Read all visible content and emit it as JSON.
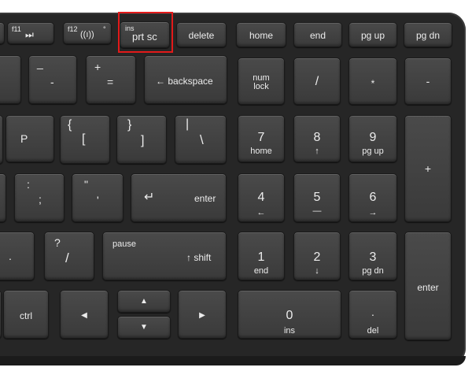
{
  "image": {
    "description_colors": {
      "frame": "#262626",
      "key": "#404040",
      "legend": "#ececec",
      "highlight": "#e21a1a"
    }
  },
  "keys": {
    "fn_next": {
      "fn": "f11",
      "icon": "⏭"
    },
    "fn_wireless": {
      "fn": "f12",
      "icon": "((ı))"
    },
    "prtsc": {
      "top": "ins",
      "main": "prt sc"
    },
    "delete": "delete",
    "home": "home",
    "end": "end",
    "pgup": "pg up",
    "pgdn": "pg dn",
    "minus": {
      "top": "_",
      "bottom": "-"
    },
    "equals": {
      "top": "+",
      "bottom": "="
    },
    "backspace": "← backspace",
    "numlock": {
      "line1": "num",
      "line2": "lock"
    },
    "num_slash": "/",
    "num_star": "*",
    "num_minus": "-",
    "p": "P",
    "lbracket": {
      "top": "{",
      "bottom": "["
    },
    "rbracket": {
      "top": "}",
      "bottom": "]"
    },
    "backslash": {
      "top": "|",
      "bottom": "\\"
    },
    "num7": {
      "digit": "7",
      "sub": "home"
    },
    "num8": {
      "digit": "8",
      "sub": "↑"
    },
    "num9": {
      "digit": "9",
      "sub": "pg up"
    },
    "num_plus": "+",
    "semicolon": {
      "top": ":",
      "bottom": ";"
    },
    "quote": {
      "top": "\"",
      "bottom": "'"
    },
    "enter": {
      "arrow": "↵",
      "label": "enter"
    },
    "num4": {
      "digit": "4",
      "sub": "←"
    },
    "num5": {
      "digit": "5",
      "sub": "—"
    },
    "num6": {
      "digit": "6",
      "sub": "→"
    },
    "period": ".",
    "slash": {
      "top": "?",
      "bottom": "/"
    },
    "rshift": {
      "top": "pause",
      "bottom": "↑ shift"
    },
    "num1": {
      "digit": "1",
      "sub": "end"
    },
    "num2": {
      "digit": "2",
      "sub": "↓"
    },
    "num3": {
      "digit": "3",
      "sub": "pg dn"
    },
    "num_enter": "enter",
    "ctrl": "ctrl",
    "left": "◀",
    "up": "▲",
    "down": "▼",
    "right": "▶",
    "num0": {
      "digit": "0",
      "sub": "ins"
    },
    "num_dot": {
      "top": ".",
      "sub": "del"
    }
  }
}
